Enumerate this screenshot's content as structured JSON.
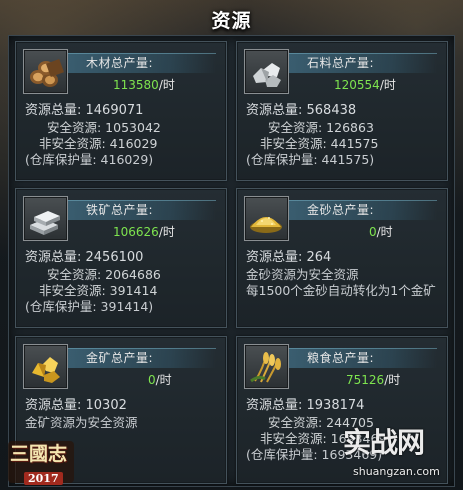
{
  "title": "资源",
  "cards": [
    {
      "icon": "wood-logs-icon",
      "label": "木材总产量:",
      "rate": "113580",
      "rate_unit": "/时",
      "total_line": "资源总量: 1469071",
      "safe_line": "安全资源: 1053042",
      "unsafe_line": "非安全资源: 416029",
      "protect_line": "(仓库保护量: 416029)"
    },
    {
      "icon": "stone-icon",
      "label": "石料总产量:",
      "rate": "120554",
      "rate_unit": "/时",
      "total_line": "资源总量: 568438",
      "safe_line": "安全资源: 126863",
      "unsafe_line": "非安全资源: 441575",
      "protect_line": "(仓库保护量: 441575)"
    },
    {
      "icon": "iron-ingot-icon",
      "label": "铁矿总产量:",
      "rate": "106626",
      "rate_unit": "/时",
      "total_line": "资源总量: 2456100",
      "safe_line": "安全资源: 2064686",
      "unsafe_line": "非安全资源: 391414",
      "protect_line": "(仓库保护量: 391414)"
    },
    {
      "icon": "gold-sand-icon",
      "label": "金砂总产量:",
      "rate": "0",
      "rate_unit": "/时",
      "total_line": "资源总量: 264",
      "note1": "金砂资源为安全资源",
      "note2": "每1500个金砂自动转化为1个金矿"
    },
    {
      "icon": "gold-ore-icon",
      "label": "金矿总产量:",
      "rate": "0",
      "rate_unit": "/时",
      "total_line": "资源总量: 10302",
      "note1": "金矿资源为安全资源"
    },
    {
      "icon": "grain-icon",
      "label": "粮食总产量:",
      "rate": "75126",
      "rate_unit": "/时",
      "total_line": "资源总量: 1938174",
      "safe_line": "安全资源: 244705",
      "unsafe_line": "非安全资源: 1693469",
      "protect_line": "(仓库保护量: 1693469)"
    }
  ],
  "logo": {
    "text": "三國志",
    "year": "2017"
  },
  "watermark": {
    "text": "实战网",
    "url": "shuangzan.com"
  },
  "colors": {
    "rate_green": "#7ee44f",
    "panel_border": "#44525b",
    "header_strip": "#4678 91"
  }
}
